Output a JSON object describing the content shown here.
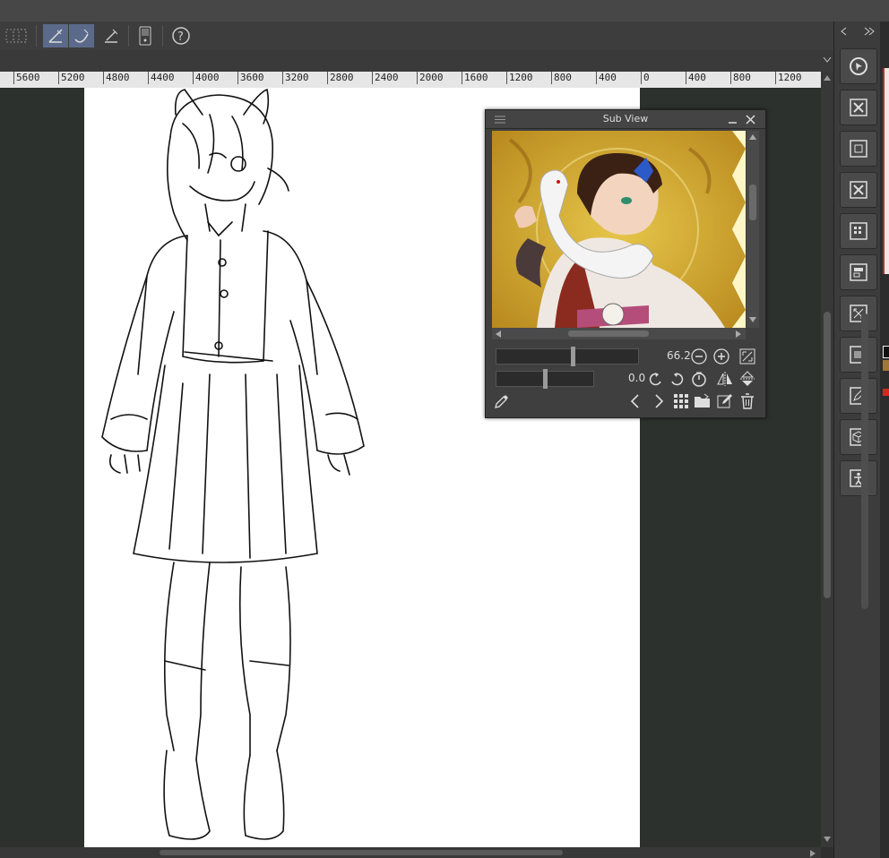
{
  "ruler": {
    "ticks": [
      "5600",
      "5200",
      "4800",
      "4400",
      "4000",
      "3600",
      "3200",
      "2800",
      "2400",
      "2000",
      "1600",
      "1200",
      "800",
      "400",
      "0",
      "400",
      "800",
      "1200"
    ]
  },
  "subview": {
    "title": "Sub View",
    "zoom_value": "66.2",
    "rotation_value": "0.0"
  },
  "colors": {
    "accent": "#5b6a8a",
    "panel": "#3c3c3c",
    "canvas_bg": "#2d312e"
  }
}
